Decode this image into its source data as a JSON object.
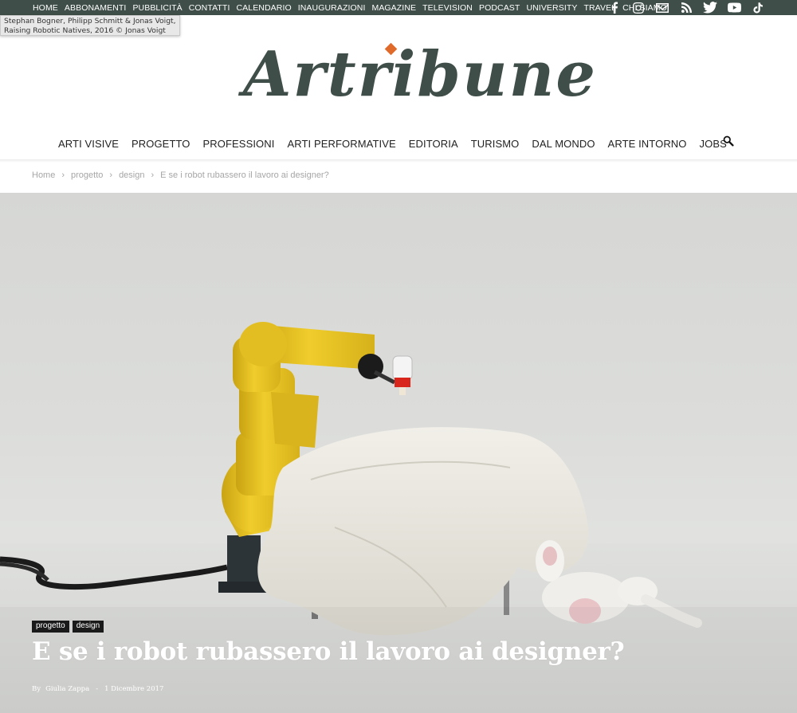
{
  "topnav": {
    "items": [
      "HOME",
      "ABBONAMENTI",
      "PUBBLICITÀ",
      "CONTATTI",
      "CALENDARIO",
      "INAUGURAZIONI",
      "MAGAZINE",
      "TELEVISION",
      "PODCAST",
      "UNIVERSITY",
      "TRAVEL",
      "CHI SIAMO"
    ]
  },
  "social": {
    "icons": [
      "facebook-icon",
      "instagram-icon",
      "mail-icon",
      "rss-icon",
      "twitter-icon",
      "youtube-icon",
      "tiktok-icon"
    ]
  },
  "tooltip": {
    "line1": "Stephan Bogner, Philipp Schmitt & Jonas Voigt,",
    "line2": "Raising Robotic Natives, 2016 © Jonas Voigt"
  },
  "logo": {
    "text": "Artribune"
  },
  "mainnav": {
    "items": [
      "ARTI VISIVE",
      "PROGETTO",
      "PROFESSIONI",
      "ARTI PERFORMATIVE",
      "EDITORIA",
      "TURISMO",
      "DAL MONDO",
      "ARTE INTORNO",
      "JOBS"
    ]
  },
  "breadcrumb": {
    "home": "Home",
    "sep": "›",
    "level1": "progetto",
    "level2": "design",
    "current": "E se i robot rubassero il lavoro ai designer?"
  },
  "article": {
    "tags": [
      "progetto",
      "design"
    ],
    "title": "E se i robot rubassero il lavoro ai designer?",
    "by_label": "By",
    "author": "Giulia Zappa",
    "date_sep": "-",
    "date": "1 Dicembre 2017"
  },
  "colors": {
    "topbar": "#3f4e48",
    "logo": "#3f4e48",
    "logo_accent": "#e06a2a",
    "robot_yellow": "#e8c21c"
  }
}
